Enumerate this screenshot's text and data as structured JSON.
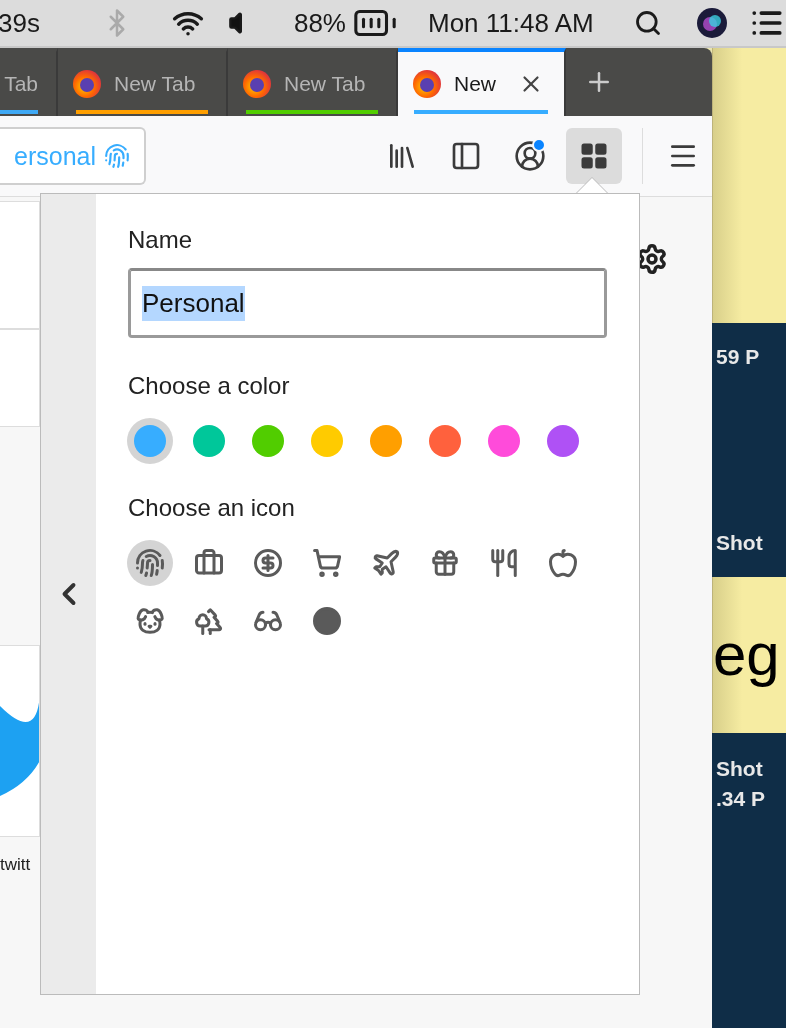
{
  "menubar": {
    "timer": "39s",
    "battery": "88%",
    "clock": "Mon 11:48 AM"
  },
  "tabs": [
    {
      "label": "Tab",
      "selected": false,
      "color": "#3fa9f5"
    },
    {
      "label": "New Tab",
      "selected": false,
      "color": "#ff9f00"
    },
    {
      "label": "New Tab",
      "selected": false,
      "color": "#51cd00"
    },
    {
      "label": "New",
      "selected": true,
      "color": "#37adff"
    }
  ],
  "toolbar": {
    "container_label": "ersonal",
    "notification": true
  },
  "page": {
    "tile_caption": "twitt"
  },
  "panel": {
    "name_label": "Name",
    "name_value": "Personal",
    "color_label": "Choose a color",
    "colors": [
      {
        "color": "#37adff",
        "selected": true
      },
      {
        "color": "#00c79a",
        "selected": false
      },
      {
        "color": "#51cd00",
        "selected": false
      },
      {
        "color": "#ffcb00",
        "selected": false
      },
      {
        "color": "#ff9f00",
        "selected": false
      },
      {
        "color": "#ff613d",
        "selected": false
      },
      {
        "color": "#ff4bda",
        "selected": false
      },
      {
        "color": "#af51f5",
        "selected": false
      }
    ],
    "icon_label": "Choose an icon",
    "icons": [
      {
        "kind": "fingerprint",
        "selected": true
      },
      {
        "kind": "briefcase",
        "selected": false
      },
      {
        "kind": "dollar",
        "selected": false
      },
      {
        "kind": "cart",
        "selected": false
      },
      {
        "kind": "plane",
        "selected": false
      },
      {
        "kind": "gift",
        "selected": false
      },
      {
        "kind": "food",
        "selected": false
      },
      {
        "kind": "fruit",
        "selected": false
      },
      {
        "kind": "pet",
        "selected": false
      },
      {
        "kind": "tree",
        "selected": false
      },
      {
        "kind": "glasses",
        "selected": false
      },
      {
        "kind": "circle",
        "selected": false
      }
    ]
  },
  "desktop": {
    "labels": [
      "59 P",
      "Shot",
      "Shot",
      ".34 P"
    ],
    "note_text": "eg"
  }
}
